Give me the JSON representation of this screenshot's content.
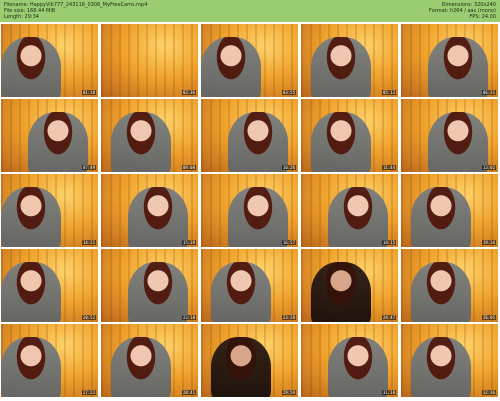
{
  "header": {
    "filename": "Filename: HappyVib777_243116_0306_MyFreeCams.mp4",
    "filesize": "File size: 168.44 MiB",
    "length": "Length: 29:34",
    "dimensions": "Dimensions: 320x240",
    "format": "Format: h264 / aac (mono)",
    "fps": "FPS: 24.00"
  },
  "thumbnails": [
    {
      "time": "01:18"
    },
    {
      "time": "02:36"
    },
    {
      "time": "03:55"
    },
    {
      "time": "05:13"
    },
    {
      "time": "06:31"
    },
    {
      "time": "07:49"
    },
    {
      "time": "09:08"
    },
    {
      "time": "10:26"
    },
    {
      "time": "11:44"
    },
    {
      "time": "13:02"
    },
    {
      "time": "14:21"
    },
    {
      "time": "15:39"
    },
    {
      "time": "16:57"
    },
    {
      "time": "18:15"
    },
    {
      "time": "19:34"
    },
    {
      "time": "20:52"
    },
    {
      "time": "22:10"
    },
    {
      "time": "23:28"
    },
    {
      "time": "24:47"
    },
    {
      "time": "26:05"
    },
    {
      "time": "27:23"
    },
    {
      "time": "28:41"
    },
    {
      "time": "29:59"
    },
    {
      "time": "31:18"
    },
    {
      "time": "32:36"
    }
  ]
}
